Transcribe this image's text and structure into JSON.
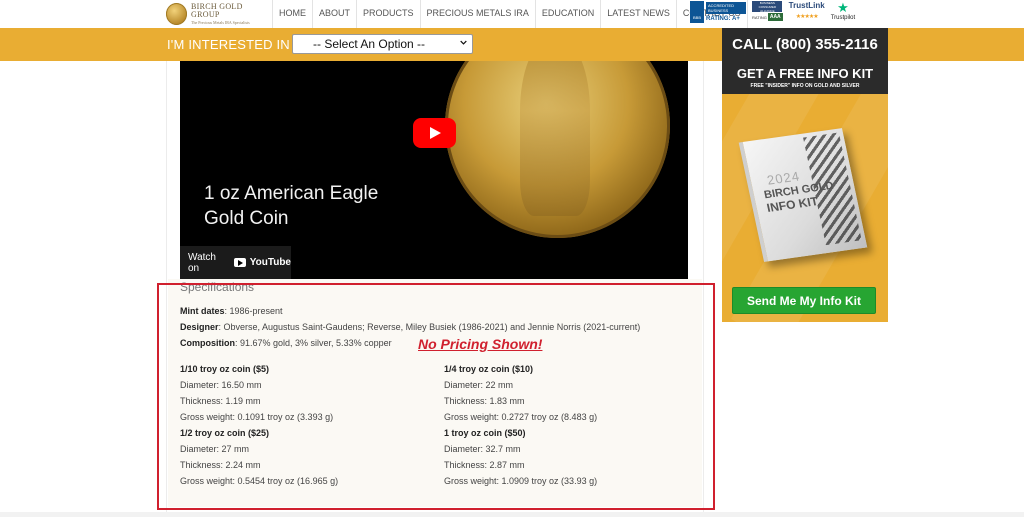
{
  "header": {
    "logo_name": "BIRCH GOLD GROUP",
    "logo_tagline": "The Precious Metals IRA Specialists",
    "nav": [
      "HOME",
      "ABOUT",
      "PRODUCTS",
      "PRECIOUS METALS IRA",
      "EDUCATION",
      "LATEST NEWS",
      "CONTACT US"
    ],
    "badges": {
      "bbb_mark": "BBB",
      "bbb_accredited": "ACCREDITED BUSINESS",
      "bbb_rating": "RATING: A+",
      "bca_name": "BUSINESS CONSUMER ALLIANCE",
      "bca_rating_label": "RATING",
      "bca_rating": "AAA",
      "trustlink": "TrustLink",
      "trustlink_stars": "★★★★★",
      "trustpilot_star": "★",
      "trustpilot": "Trustpilot"
    }
  },
  "interest_bar": {
    "label": "I'M INTERESTED IN >",
    "select_value": "-- Select An Option --"
  },
  "video": {
    "title_line1": "1 oz American Eagle",
    "title_line2": "Gold Coin",
    "watch_label": "Watch on",
    "youtube_label": "YouTube"
  },
  "specs": {
    "heading": "Specifications",
    "mint_dates_label": "Mint dates",
    "mint_dates": ": 1986-present",
    "designer_label": "Designer",
    "designer": ": Obverse, Augustus Saint-Gaudens; Reverse, Miley Busiek (1986-2021) and Jennie Norris (2021-current)",
    "composition_label": "Composition",
    "composition": ": 91.67% gold, 3% silver, 5.33% copper",
    "annotation": "No Pricing Shown!",
    "coins": [
      {
        "title": "1/10 troy oz coin ($5)",
        "diameter": "Diameter: 16.50 mm",
        "thickness": "Thickness: 1.19 mm",
        "weight": "Gross weight: 0.1091 troy oz (3.393 g)"
      },
      {
        "title": "1/4 troy oz coin ($10)",
        "diameter": "Diameter: 22 mm",
        "thickness": "Thickness: 1.83 mm",
        "weight": "Gross weight: 0.2727 troy oz (8.483 g)"
      },
      {
        "title": "1/2 troy oz coin ($25)",
        "diameter": "Diameter: 27 mm",
        "thickness": "Thickness: 2.24 mm",
        "weight": "Gross weight: 0.5454 troy oz (16.965 g)"
      },
      {
        "title": "1 troy oz coin ($50)",
        "diameter": "Diameter: 32.7 mm",
        "thickness": "Thickness: 2.87 mm",
        "weight": "Gross weight: 1.0909 troy oz (33.93 g)"
      }
    ]
  },
  "sidebar": {
    "phone": "CALL (800) 355-2116",
    "kit_title": "GET A FREE INFO KIT",
    "kit_subtitle": "FREE \"INSIDER\" INFO ON GOLD AND SILVER",
    "book_year": "2024",
    "book_line1": "BIRCH GOLD",
    "book_line2": "INFO KIT",
    "button": "Send Me My Info Kit"
  },
  "colors": {
    "gold": "#e9ad33",
    "dark": "#2b2b2b",
    "green": "#27a532",
    "red": "#d0202e"
  }
}
